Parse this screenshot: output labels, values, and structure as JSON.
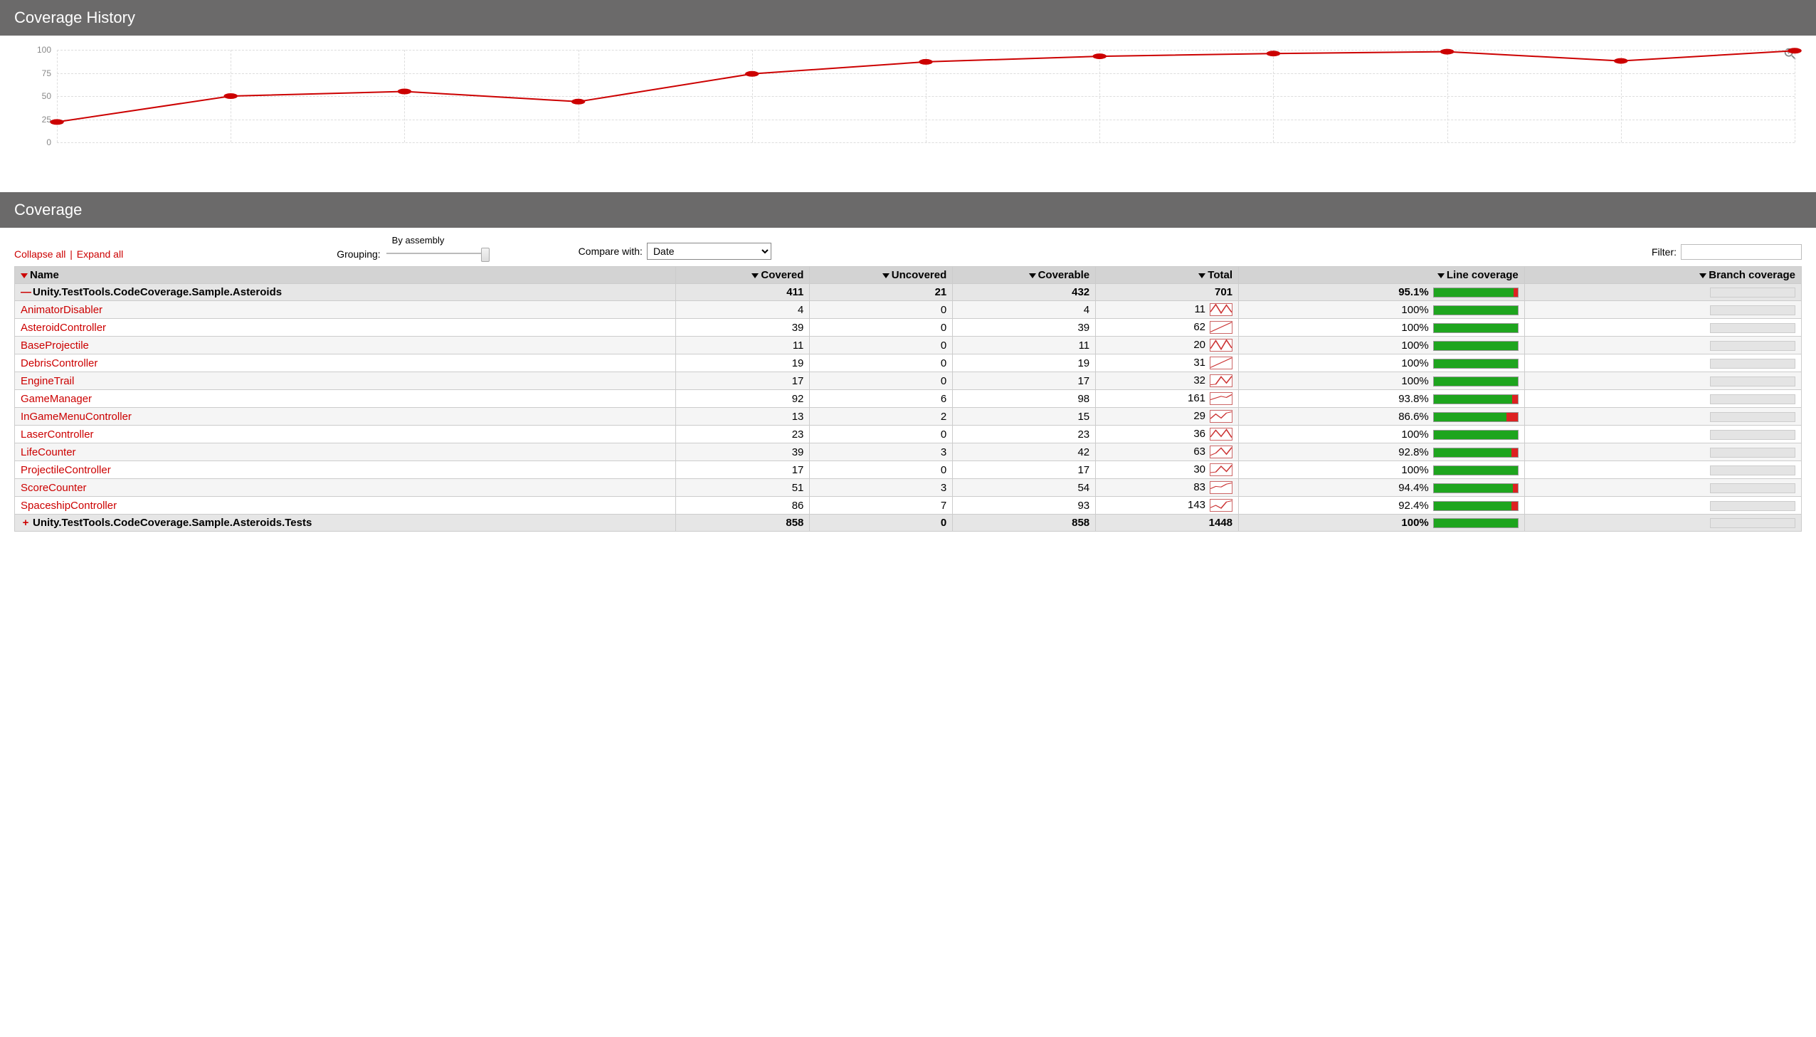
{
  "history_header": "Coverage History",
  "coverage_header": "Coverage",
  "controls": {
    "collapse": "Collapse all",
    "expand": "Expand all",
    "grouping_label": "Grouping:",
    "grouping_value": "By assembly",
    "compare_label": "Compare with:",
    "compare_value": "Date",
    "filter_label": "Filter:"
  },
  "columns": {
    "name": "Name",
    "covered": "Covered",
    "uncovered": "Uncovered",
    "coverable": "Coverable",
    "total": "Total",
    "line_cov": "Line coverage",
    "branch_cov": "Branch coverage"
  },
  "chart_data": {
    "type": "line",
    "ylim": [
      0,
      100
    ],
    "yticks": [
      0,
      25,
      50,
      75,
      100
    ],
    "values": [
      22,
      50,
      55,
      44,
      74,
      87,
      93,
      96,
      98,
      88,
      99
    ],
    "title": "Coverage History"
  },
  "rows": [
    {
      "type": "assembly",
      "expander": "—",
      "name": "Unity.TestTools.CodeCoverage.Sample.Asteroids",
      "covered": 411,
      "uncovered": 21,
      "coverable": 432,
      "total": 701,
      "pct": 95.1,
      "spark": false
    },
    {
      "type": "class",
      "name": "AnimatorDisabler",
      "covered": 4,
      "uncovered": 0,
      "coverable": 4,
      "total": 11,
      "pct": 100,
      "spark": [
        30,
        95,
        20,
        90,
        25
      ]
    },
    {
      "type": "class",
      "name": "AsteroidController",
      "covered": 39,
      "uncovered": 0,
      "coverable": 39,
      "total": 62,
      "pct": 100,
      "spark": [
        10,
        95
      ]
    },
    {
      "type": "class",
      "name": "BaseProjectile",
      "covered": 11,
      "uncovered": 0,
      "coverable": 11,
      "total": 20,
      "pct": 100,
      "spark": [
        20,
        90,
        15,
        95,
        25
      ]
    },
    {
      "type": "class",
      "name": "DebrisController",
      "covered": 19,
      "uncovered": 0,
      "coverable": 19,
      "total": 31,
      "pct": 100,
      "spark": [
        10,
        95
      ]
    },
    {
      "type": "class",
      "name": "EngineTrail",
      "covered": 17,
      "uncovered": 0,
      "coverable": 17,
      "total": 32,
      "pct": 100,
      "spark": [
        15,
        20,
        85,
        30,
        90
      ]
    },
    {
      "type": "class",
      "name": "GameManager",
      "covered": 92,
      "uncovered": 6,
      "coverable": 98,
      "total": 161,
      "pct": 93.8,
      "spark": [
        40,
        55,
        70,
        60,
        85
      ]
    },
    {
      "type": "class",
      "name": "InGameMenuController",
      "covered": 13,
      "uncovered": 2,
      "coverable": 15,
      "total": 29,
      "pct": 86.6,
      "spark": [
        30,
        70,
        35,
        80,
        90
      ]
    },
    {
      "type": "class",
      "name": "LaserController",
      "covered": 23,
      "uncovered": 0,
      "coverable": 23,
      "total": 36,
      "pct": 100,
      "spark": [
        25,
        85,
        30,
        90,
        20
      ]
    },
    {
      "type": "class",
      "name": "LifeCounter",
      "covered": 39,
      "uncovered": 3,
      "coverable": 42,
      "total": 63,
      "pct": 92.8,
      "spark": [
        20,
        40,
        85,
        30,
        90
      ]
    },
    {
      "type": "class",
      "name": "ProjectileController",
      "covered": 17,
      "uncovered": 0,
      "coverable": 17,
      "total": 30,
      "pct": 100,
      "spark": [
        25,
        30,
        80,
        35,
        90
      ]
    },
    {
      "type": "class",
      "name": "ScoreCounter",
      "covered": 51,
      "uncovered": 3,
      "coverable": 54,
      "total": 83,
      "pct": 94.4,
      "spark": [
        40,
        60,
        55,
        80,
        90
      ]
    },
    {
      "type": "class",
      "name": "SpaceshipController",
      "covered": 86,
      "uncovered": 7,
      "coverable": 93,
      "total": 143,
      "pct": 92.4,
      "spark": [
        30,
        50,
        25,
        80,
        90
      ]
    },
    {
      "type": "assembly",
      "expander": "+",
      "name": "Unity.TestTools.CodeCoverage.Sample.Asteroids.Tests",
      "covered": 858,
      "uncovered": 0,
      "coverable": 858,
      "total": 1448,
      "pct": 100,
      "spark": false
    }
  ]
}
